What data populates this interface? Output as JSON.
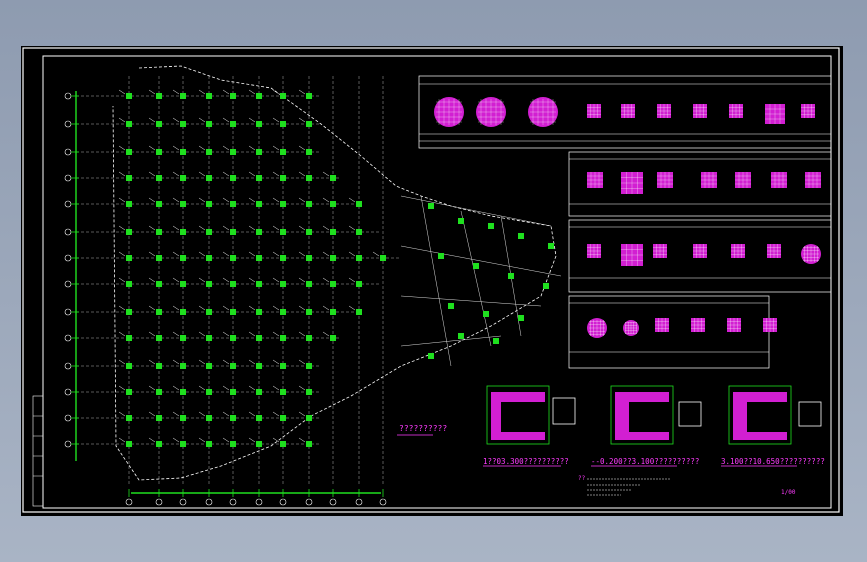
{
  "drawing": {
    "plan_caption": "??????????",
    "section_labels": [
      "1??03.300??????????",
      "--0.200??3.100??????????",
      "3.100??10.650??????????"
    ],
    "page_number": "1/00",
    "notes_heading": "??"
  },
  "colors": {
    "background": "#000000",
    "frame": "#ffffff",
    "columns": "#1fe01f",
    "sections": "#d21fd2",
    "title_text": "#ff3cff"
  }
}
